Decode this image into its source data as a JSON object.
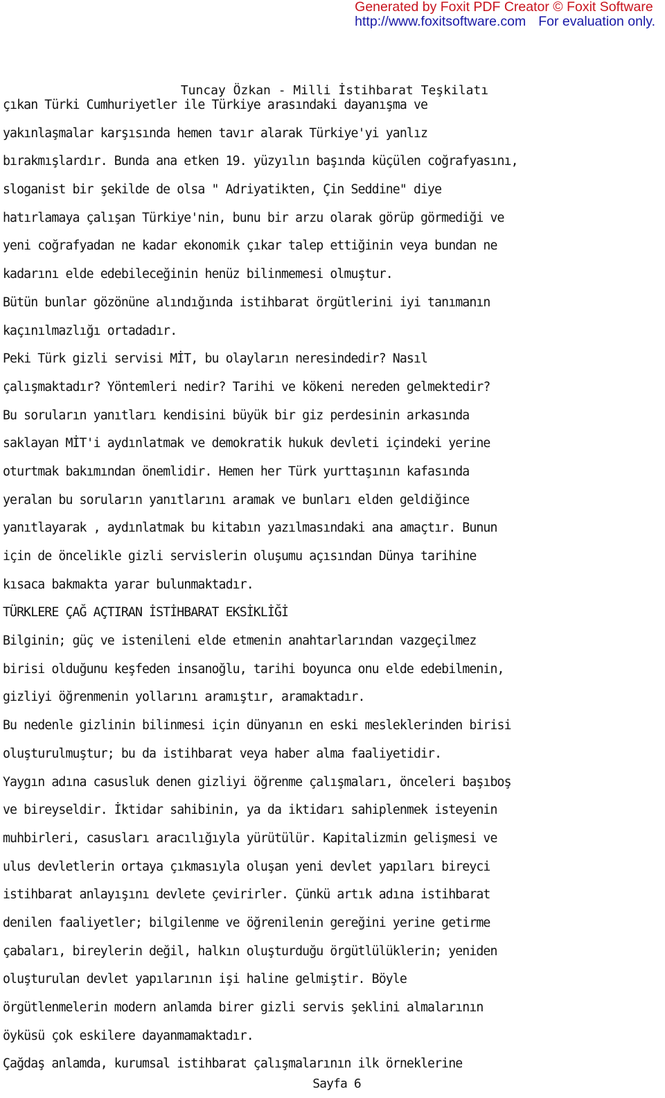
{
  "watermark": {
    "line1": "Generated by Foxit PDF Creator © Foxit Software",
    "url": "http://www.foxitsoftware.com",
    "note": "For evaluation only.",
    "colors": {
      "line1": "#c8141e",
      "line2": "#1a1aa6"
    }
  },
  "header": "Tuncay Özkan - Milli İstihbarat Teşkilatı",
  "lines": [
    "çıkan Türki Cumhuriyetler ile Türkiye arasındaki dayanışma ve",
    "yakınlaşmalar karşısında hemen tavır alarak Türkiye'yi yanlız",
    "bırakmışlardır. Bunda ana etken 19. yüzyılın başında küçülen coğrafyasını,",
    "sloganist bir şekilde de olsa \" Adriyatikten, Çin Seddine\" diye",
    "hatırlamaya çalışan Türkiye'nin, bunu bir arzu olarak görüp görmediği ve",
    "yeni coğrafyadan ne kadar ekonomik çıkar talep ettiğinin veya bundan ne",
    "kadarını elde edebileceğinin henüz bilinmemesi olmuştur.",
    "Bütün bunlar gözönüne alındığında istihbarat örgütlerini iyi tanımanın",
    "kaçınılmazlığı ortadadır.",
    "Peki Türk gizli servisi MİT, bu olayların neresindedir? Nasıl",
    "çalışmaktadır? Yöntemleri nedir? Tarihi ve kökeni nereden gelmektedir?",
    "Bu soruların yanıtları kendisini büyük bir giz perdesinin arkasında",
    "saklayan MİT'i aydınlatmak ve demokratik hukuk devleti içindeki yerine",
    "oturtmak bakımından önemlidir. Hemen her Türk yurttaşının kafasında",
    "yeralan bu soruların yanıtlarını aramak ve bunları elden geldiğince",
    "yanıtlayarak , aydınlatmak bu kitabın yazılmasındaki ana amaçtır. Bunun",
    "için de öncelikle gizli servislerin oluşumu açısından Dünya tarihine",
    "kısaca bakmakta yarar bulunmaktadır.",
    "TÜRKLERE ÇAĞ AÇTIRAN İSTİHBARAT EKSİKLİĞİ",
    "Bilginin; güç ve istenileni elde etmenin anahtarlarından vazgeçilmez",
    "birisi olduğunu keşfeden insanoğlu, tarihi boyunca onu elde edebilmenin,",
    "gizliyi öğrenmenin yollarını aramıştır, aramaktadır.",
    "Bu nedenle gizlinin bilinmesi için dünyanın en eski mesleklerinden birisi",
    "oluşturulmuştur; bu da istihbarat veya haber alma faaliyetidir.",
    "Yaygın adına casusluk denen gizliyi öğrenme çalışmaları, önceleri başıboş",
    "ve bireyseldir. İktidar sahibinin, ya da iktidarı sahiplenmek isteyenin",
    "muhbirleri, casusları aracılığıyla yürütülür. Kapitalizmin gelişmesi ve",
    "ulus devletlerin ortaya çıkmasıyla oluşan yeni devlet yapıları bireyci",
    "istihbarat anlayışını devlete çevirirler. Çünkü artık adına istihbarat",
    "denilen faaliyetler; bilgilenme ve öğrenilenin gereğini yerine getirme",
    "çabaları, bireylerin değil, halkın oluşturduğu örgütlülüklerin; yeniden",
    "oluşturulan devlet yapılarının işi haline gelmiştir. Böyle",
    "örgütlenmelerin modern anlamda birer gizli servis şeklini almalarının",
    "öyküsü çok eskilere dayanmamaktadır.",
    "Çağdaş anlamda, kurumsal istihbarat çalışmalarının ilk örneklerine"
  ],
  "footer": "Sayfa 6"
}
